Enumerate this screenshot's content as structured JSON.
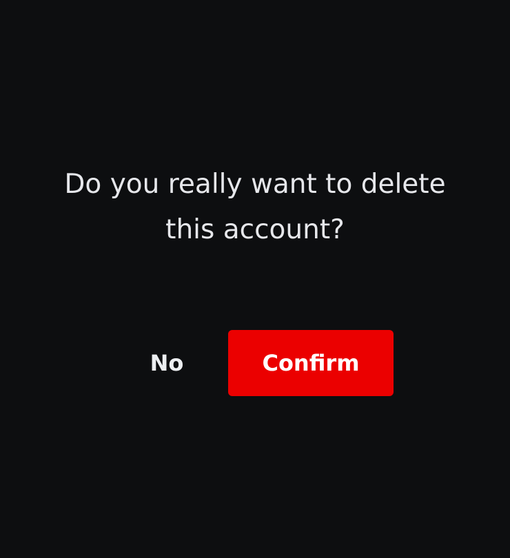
{
  "dialog": {
    "message_line1": "Do you really want to delete",
    "message_line2": "this account?",
    "no_label": "No",
    "confirm_label": "Confirm"
  },
  "colors": {
    "background": "#0d0e10",
    "text": "#e6e7eb",
    "confirm_button": "#eb0000"
  }
}
